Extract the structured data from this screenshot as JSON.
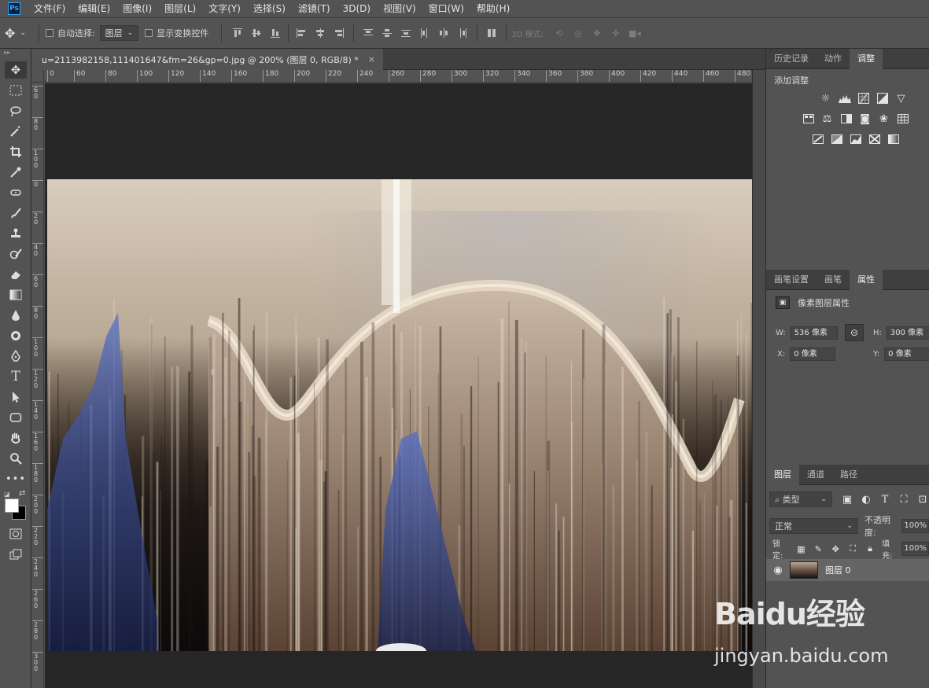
{
  "app": {
    "logo": "Ps"
  },
  "menu": [
    "文件(F)",
    "编辑(E)",
    "图像(I)",
    "图层(L)",
    "文字(Y)",
    "选择(S)",
    "滤镜(T)",
    "3D(D)",
    "视图(V)",
    "窗口(W)",
    "帮助(H)"
  ],
  "options": {
    "auto_select_label": "自动选择:",
    "auto_select_value": "图层",
    "show_transform_label": "显示变换控件",
    "mode_3d_label": "3D 模式:"
  },
  "document": {
    "tab_title": "u=2113982158,111401647&fm=26&gp=0.jpg @ 200% (图层 0, RGB/8) *",
    "close": "×"
  },
  "ruler_h": [
    "0",
    "60",
    "80",
    "100",
    "120",
    "140",
    "160",
    "180",
    "200",
    "220",
    "240",
    "260",
    "280",
    "300",
    "320",
    "340",
    "360",
    "380",
    "400",
    "420",
    "440",
    "460",
    "480"
  ],
  "ruler_v": [
    "6 0",
    "8 0",
    "1 0 0",
    "0",
    "2 0",
    "4 0",
    "6 0",
    "8 0",
    "1 0 0",
    "1 2 0",
    "1 4 0",
    "1 6 0",
    "1 8 0",
    "2 0 0",
    "2 2 0",
    "2 4 0",
    "2 6 0",
    "2 8 0",
    "3 0 0"
  ],
  "panels": {
    "top_tabs": [
      "历史记录",
      "动作",
      "调整"
    ],
    "adjust_title": "添加调整",
    "mid_tabs": [
      "画笔设置",
      "画笔",
      "属性"
    ],
    "properties_title": "像素图层属性",
    "w_label": "W:",
    "w_value": "536 像素",
    "h_label": "H:",
    "h_value": "300 像素",
    "x_label": "X:",
    "x_value": "0 像素",
    "y_label": "Y:",
    "y_value": "0 像素",
    "layers_tabs": [
      "图层",
      "通道",
      "路径"
    ],
    "filter_kind": "类型",
    "blend_mode": "正常",
    "opacity_label": "不透明度:",
    "opacity_value": "100%",
    "lock_label": "锁定:",
    "fill_label": "填充:",
    "fill_value": "100%",
    "layer_name": "图层 0"
  },
  "watermark": {
    "brand": "Baidu经验",
    "url": "jingyan.baidu.com"
  }
}
